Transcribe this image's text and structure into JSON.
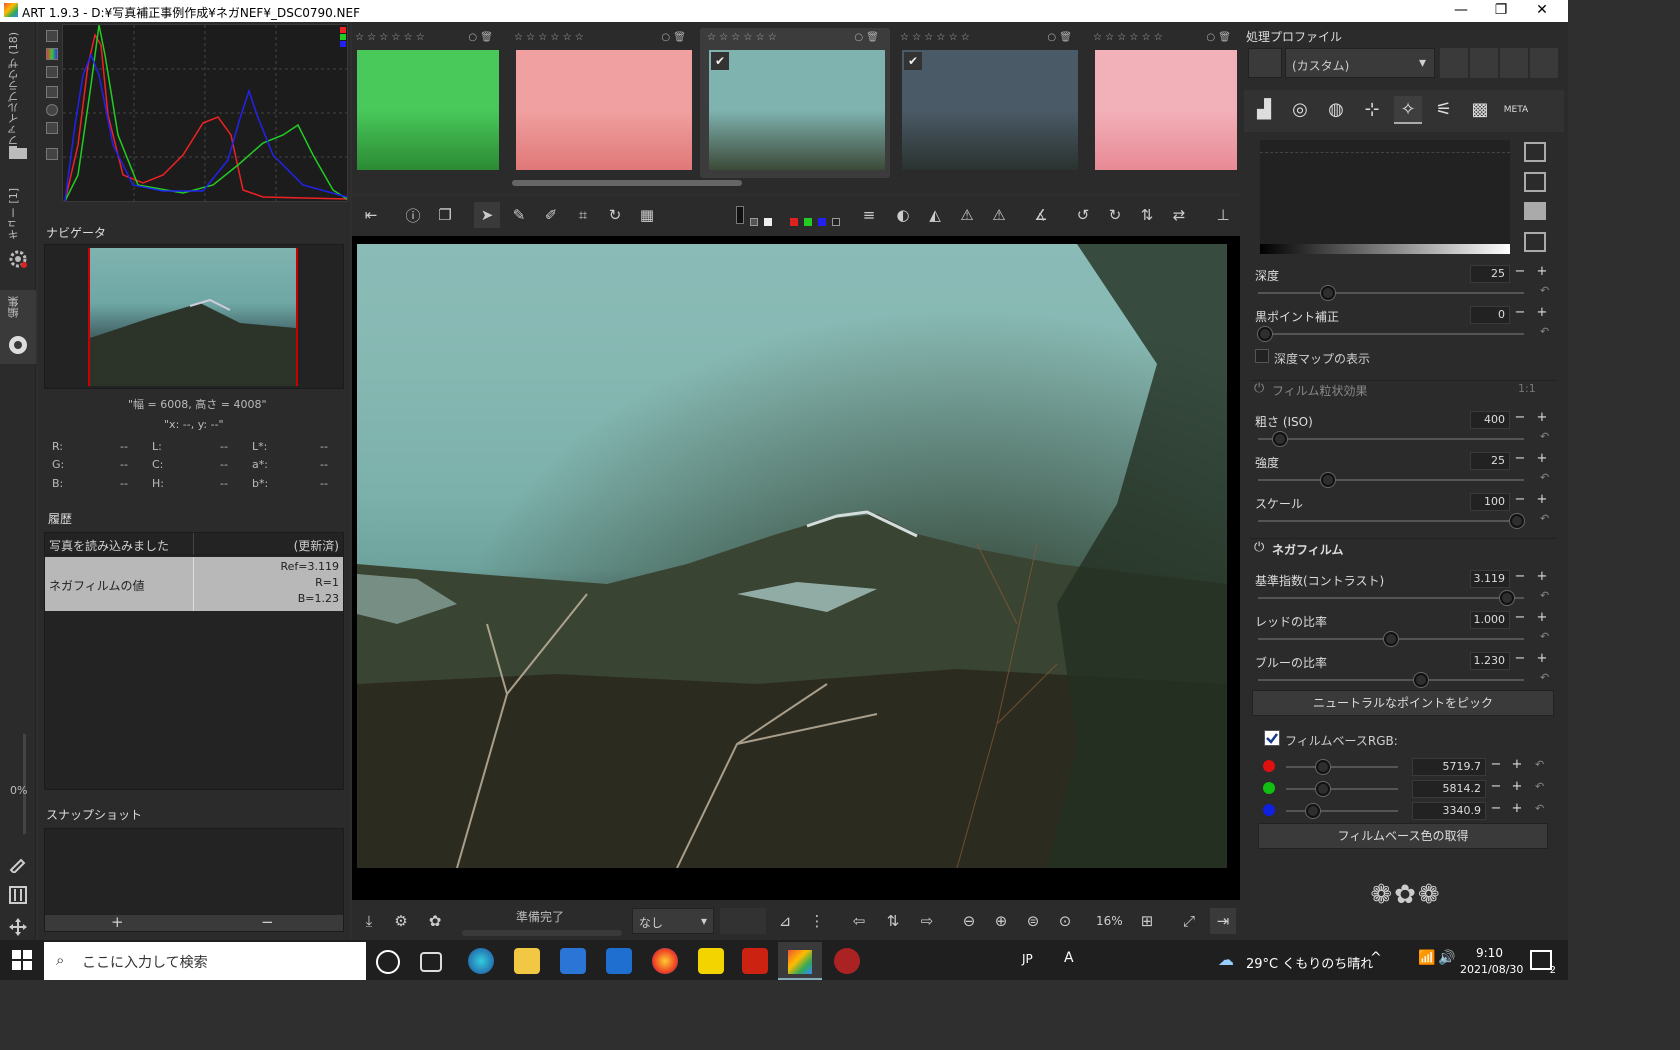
{
  "window": {
    "title": "ART 1.9.3 - D:¥写真補正事例作成¥ネガNEF¥_DSC0790.NEF",
    "min": "—",
    "max": "❐",
    "close": "✕"
  },
  "left_vtabs": {
    "file_browser": "ファイルブラウザ (18)",
    "queue": "キュー [1]",
    "edit": "編集"
  },
  "left_vbar": {
    "zoom_pct": "0%"
  },
  "navigator": {
    "title": "ナビゲータ",
    "size_text": "\"幅 = 6008, 高さ = 4008\"",
    "xy_text": "\"x: --, y: --\"",
    "readouts": [
      {
        "k": "R:",
        "v": "--"
      },
      {
        "k": "L:",
        "v": "--"
      },
      {
        "k": "L*:",
        "v": "--"
      },
      {
        "k": "G:",
        "v": "--"
      },
      {
        "k": "C:",
        "v": "--"
      },
      {
        "k": "a*:",
        "v": "--"
      },
      {
        "k": "B:",
        "v": "--"
      },
      {
        "k": "H:",
        "v": "--"
      },
      {
        "k": "b*:",
        "v": "--"
      }
    ]
  },
  "history": {
    "title": "履歴",
    "rows": [
      {
        "action": "写真を読み込みました",
        "value": "(更新済)"
      },
      {
        "action": "ネガフィルムの値",
        "value_lines": [
          "Ref=3.119",
          "R=1",
          "B=1.23"
        ]
      }
    ]
  },
  "snapshots": {
    "title": "スナップショット",
    "add": "+",
    "remove": "−"
  },
  "filmstrip": {
    "thumbs": [
      {
        "colors": [
          "#49c95a",
          "#2c8a34"
        ],
        "checked": false
      },
      {
        "colors": [
          "#f0a0a0",
          "#e07878"
        ],
        "checked": false
      },
      {
        "colors": [
          "#7fb3b0",
          "#3c4a38"
        ],
        "checked": true,
        "selected": true
      },
      {
        "colors": [
          "#4a5a66",
          "#2b3330"
        ],
        "checked": true
      },
      {
        "colors": [
          "#f2b0b8",
          "#e88a96"
        ],
        "checked": false
      }
    ]
  },
  "statusbar": {
    "status": "準備完了",
    "filter_select": "なし",
    "zoom": "16%"
  },
  "profile": {
    "title": "処理プロファイル",
    "select": "(カスタム)"
  },
  "tool_tabs": [
    "exposure",
    "detail",
    "color",
    "transform",
    "effects",
    "raw",
    "advanced",
    "META"
  ],
  "haze": {
    "depth_label": "深度",
    "depth_val": "25",
    "depth_frac": 0.25,
    "black_label": "黒ポイント補正",
    "black_val": "0",
    "black_frac": 0.0,
    "map_label": "深度マップの表示"
  },
  "grain": {
    "title": "フィルム粒状効果",
    "ratio": "1:1",
    "iso_label": "粗さ (ISO)",
    "iso_val": "400",
    "iso_frac": 0.06,
    "strength_label": "強度",
    "strength_val": "25",
    "strength_frac": 0.25,
    "scale_label": "スケール",
    "scale_val": "100",
    "scale_frac": 1.0
  },
  "negfilm": {
    "title": "ネガフィルム",
    "ref_label": "基準指数(コントラスト)",
    "ref_val": "3.119",
    "ref_frac": 0.96,
    "red_label": "レッドの比率",
    "red_val": "1.000",
    "red_frac": 0.5,
    "blue_label": "ブルーの比率",
    "blue_val": "1.230",
    "blue_frac": 0.62,
    "pick_btn": "ニュートラルなポイントをピック",
    "base_label": "フィルムベースRGB:",
    "base": [
      {
        "color": "#e01010",
        "val": "5719.7",
        "frac": 0.3
      },
      {
        "color": "#10c010",
        "val": "5814.2",
        "frac": 0.3
      },
      {
        "color": "#1020e0",
        "val": "3340.9",
        "frac": 0.2
      }
    ],
    "get_btn": "フィルムベース色の取得"
  },
  "taskbar": {
    "search_placeholder": "ここに入力して検索",
    "lang": "JP",
    "ime": "A",
    "weather": "29°C くもりのち晴れ",
    "time": "9:10",
    "date": "2021/08/30",
    "notif": "2"
  }
}
